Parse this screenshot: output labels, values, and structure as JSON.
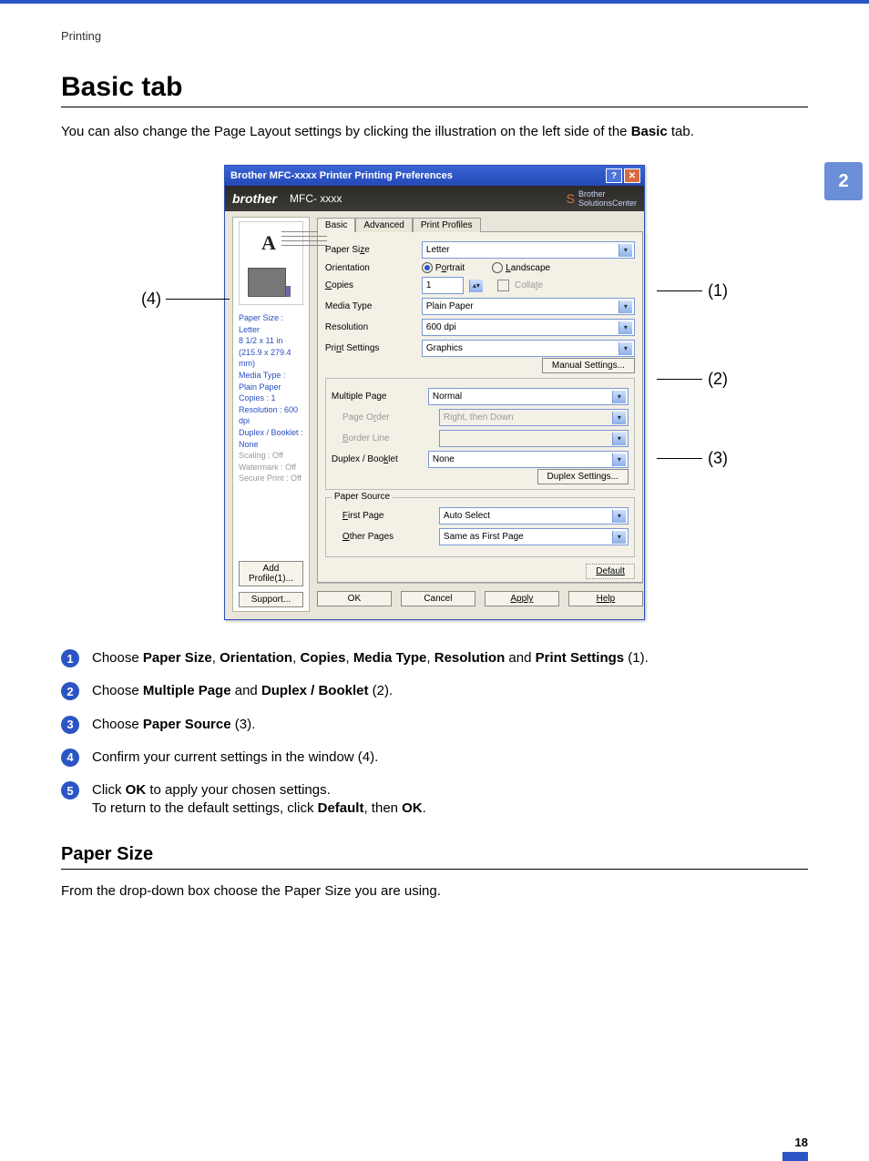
{
  "header": {
    "section": "Printing"
  },
  "title": "Basic tab",
  "intro_a": "You can also change the Page Layout settings by clicking the illustration on the left side of the ",
  "intro_b": "Basic",
  "intro_c": " tab.",
  "chapter": "2",
  "callouts": {
    "c1": "(1)",
    "c2": "(2)",
    "c3": "(3)",
    "c4": "(4)"
  },
  "dialog": {
    "title": "Brother MFC-xxxx Printer Printing Preferences",
    "brand": "brother",
    "model": "MFC- xxxx",
    "solutions": "Brother\nSolutionsCenter",
    "tabs": {
      "basic": "Basic",
      "advanced": "Advanced",
      "profiles": "Print Profiles"
    },
    "labels": {
      "paper_size": "Paper Size",
      "orientation": "Orientation",
      "copies": "Copies",
      "media_type": "Media Type",
      "resolution": "Resolution",
      "print_settings": "Print Settings",
      "multiple_page": "Multiple Page",
      "page_order": "Page Order",
      "border_line": "Border Line",
      "duplex_booklet": "Duplex / Booklet",
      "paper_source": "Paper Source",
      "first_page": "First Page",
      "other_pages": "Other Pages"
    },
    "values": {
      "paper_size": "Letter",
      "portrait": "Portrait",
      "landscape": "Landscape",
      "copies": "1",
      "collate": "Collate",
      "media_type": "Plain Paper",
      "resolution": "600 dpi",
      "print_settings": "Graphics",
      "multiple_page": "Normal",
      "page_order": "Right, then Down",
      "duplex_booklet": "None",
      "first_page": "Auto Select",
      "other_pages": "Same as First Page"
    },
    "buttons": {
      "manual": "Manual Settings...",
      "duplex": "Duplex Settings...",
      "default": "Default",
      "ok": "OK",
      "cancel": "Cancel",
      "apply": "Apply",
      "help": "Help",
      "add_profile": "Add Profile(1)...",
      "support": "Support..."
    },
    "info": {
      "l1": "Paper Size : Letter",
      "l2": "8 1/2 x 11 in",
      "l3": "(215.9 x 279.4 mm)",
      "l4": "Media Type : Plain Paper",
      "l5": "Copies : 1",
      "l6": "Resolution : 600 dpi",
      "l7": "Duplex / Booklet : None",
      "l8": "Scaling : Off",
      "l9": "Watermark : Off",
      "l10": "Secure Print : Off"
    }
  },
  "steps": {
    "s1": {
      "a": "Choose ",
      "paper": "Paper Size",
      "c1": ", ",
      "orient": "Orientation",
      "c2": ", ",
      "copies": "Copies",
      "c3": ", ",
      "media": "Media Type",
      "c4": ", ",
      "res": "Resolution",
      "and": " and ",
      "ps": "Print Settings",
      "tail": " (1)."
    },
    "s2": {
      "a": "Choose ",
      "mp": "Multiple Page",
      "and": " and ",
      "db": "Duplex / Booklet",
      "tail": " (2)."
    },
    "s3": {
      "a": "Choose ",
      "psrc": "Paper Source",
      "tail": " (3)."
    },
    "s4": "Confirm your current settings in the window (4).",
    "s5a": "Click ",
    "s5ok": "OK",
    "s5b": " to apply your chosen settings.",
    "s5c": "To return to the default settings, click ",
    "s5def": "Default",
    "s5then": ", then ",
    "s5ok2": "OK",
    "s5dot": "."
  },
  "subhead": "Paper Size",
  "body": "From the drop-down box choose the Paper Size you are using.",
  "pagenum": "18"
}
